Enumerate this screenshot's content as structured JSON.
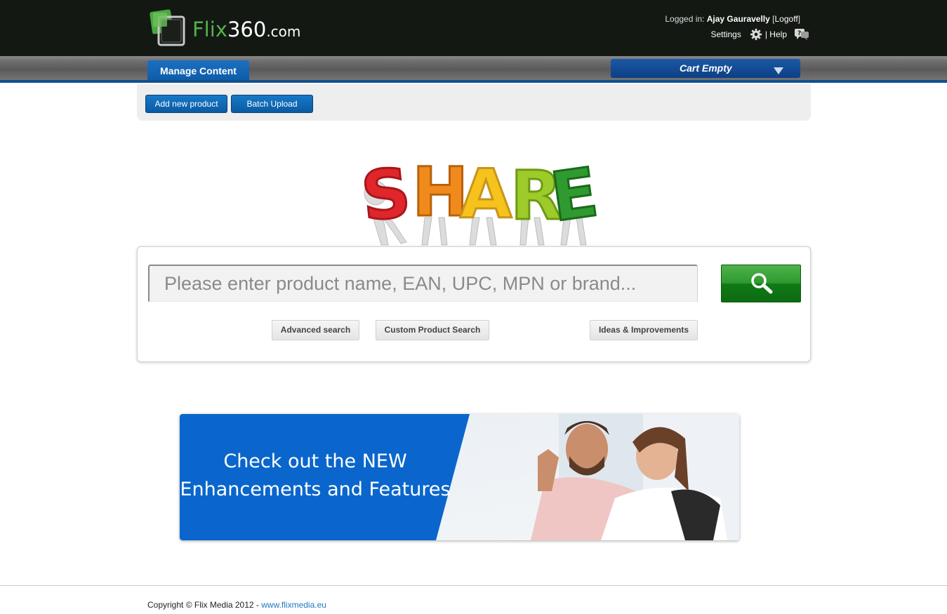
{
  "header": {
    "logo_main": "Flix",
    "logo_num": "360",
    "logo_suffix": ".com",
    "logged_in_label": "Logged in:",
    "user_name": "Ajay Gauravelly",
    "logoff_open": "[",
    "logoff_label": "Logoff",
    "logoff_close": "]",
    "settings_label": "Settings",
    "help_label": "| Help"
  },
  "nav": {
    "tab_label": "Manage Content",
    "cart_label": "Cart Empty"
  },
  "toolbar": {
    "add_product_label": "Add new product",
    "batch_upload_label": "Batch Upload"
  },
  "share_graphic": {
    "letters": [
      "S",
      "H",
      "A",
      "R",
      "E"
    ],
    "colors": [
      "#e0262a",
      "#f08a1c",
      "#f6c21c",
      "#9ccb2a",
      "#2f9a2f"
    ]
  },
  "search": {
    "placeholder": "Please enter product name, EAN, UPC, MPN or brand...",
    "value": "",
    "advanced_label": "Advanced search",
    "custom_label": "Custom Product Search",
    "ideas_label": "Ideas & Improvements"
  },
  "banner": {
    "line1_prefix": "Check out the ",
    "line1_emphasis": "NEW",
    "line2": "Enhancements and Features"
  },
  "footer": {
    "copyright": "Copyright © Flix Media 2012 - ",
    "link_label": "www.flixmedia.eu"
  },
  "colors": {
    "header_bg": "#131813",
    "brand_green": "#55b048",
    "nav_blue": "#0d5aa6",
    "search_green": "#2f9a2f",
    "banner_blue": "#0a66cc"
  }
}
